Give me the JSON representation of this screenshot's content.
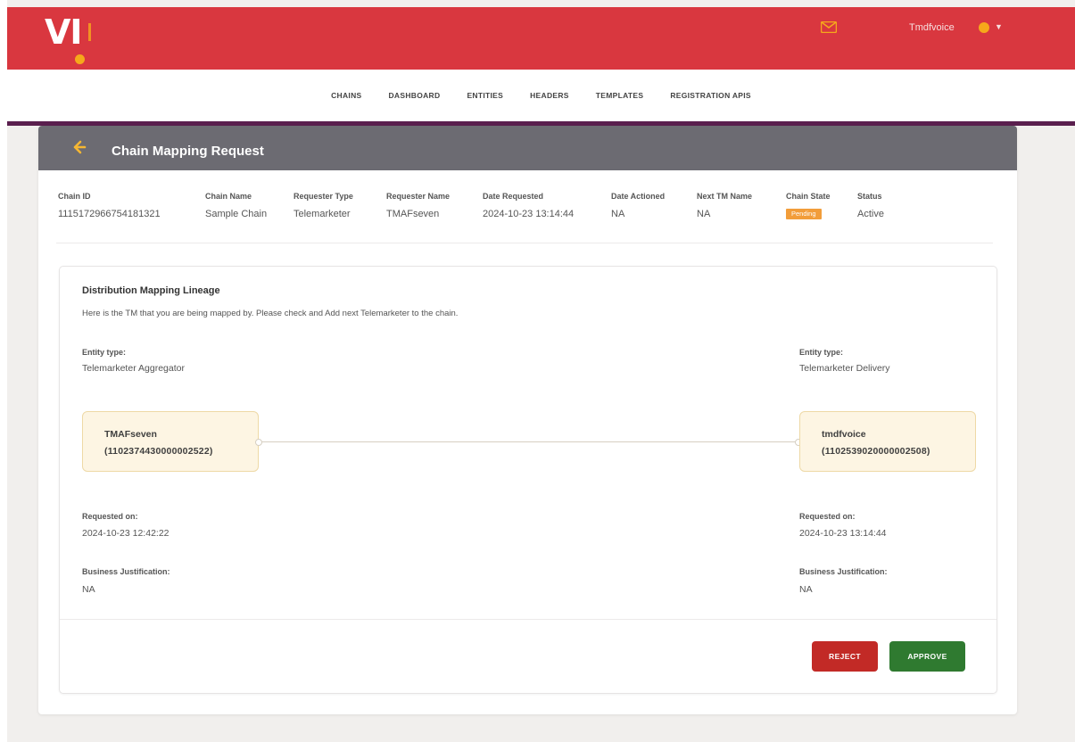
{
  "app": {
    "logo_text": "VI",
    "user_name": "Tmdfvoice"
  },
  "nav": {
    "items": [
      "CHAINS",
      "DASHBOARD",
      "ENTITIES",
      "HEADERS",
      "TEMPLATES",
      "REGISTRATION APIS"
    ]
  },
  "page": {
    "title": "Chain Mapping Request"
  },
  "meta": {
    "chain_id": {
      "label": "Chain ID",
      "value": "1115172966754181321"
    },
    "chain_name": {
      "label": "Chain Name",
      "value": "Sample Chain"
    },
    "requester_type": {
      "label": "Requester Type",
      "value": "Telemarketer"
    },
    "requester_name": {
      "label": "Requester Name",
      "value": "TMAFseven"
    },
    "date_requested": {
      "label": "Date Requested",
      "value": "2024-10-23 13:14:44"
    },
    "date_actioned": {
      "label": "Date Actioned",
      "value": "NA"
    },
    "next_tm_name": {
      "label": "Next TM Name",
      "value": "NA"
    },
    "chain_state": {
      "label": "Chain State",
      "value": "Pending"
    },
    "status": {
      "label": "Status",
      "value": "Active"
    }
  },
  "lineage": {
    "title": "Distribution Mapping Lineage",
    "description": "Here is the TM that you are being mapped by. Please check and Add next Telemarketer to the chain.",
    "left": {
      "entity_type_label": "Entity type:",
      "entity_type": "Telemarketer Aggregator",
      "node_name": "TMAFseven",
      "node_id": "(1102374430000002522)",
      "requested_on_label": "Requested on:",
      "requested_on": "2024-10-23 12:42:22",
      "justification_label": "Business Justification:",
      "justification": "NA"
    },
    "right": {
      "entity_type_label": "Entity type:",
      "entity_type": "Telemarketer Delivery",
      "node_name": "tmdfvoice",
      "node_id": "(1102539020000002508)",
      "requested_on_label": "Requested on:",
      "requested_on": "2024-10-23 13:14:44",
      "justification_label": "Business Justification:",
      "justification": "NA"
    }
  },
  "actions": {
    "reject_label": "REJECT",
    "approve_label": "APPROVE"
  },
  "colors": {
    "brand_red": "#d9373f",
    "accent_yellow": "#f6a81b",
    "header_gray": "#6c6b72",
    "pending_orange": "#f29d3a",
    "reject_red": "#c22a26",
    "approve_green": "#2f7a30"
  }
}
